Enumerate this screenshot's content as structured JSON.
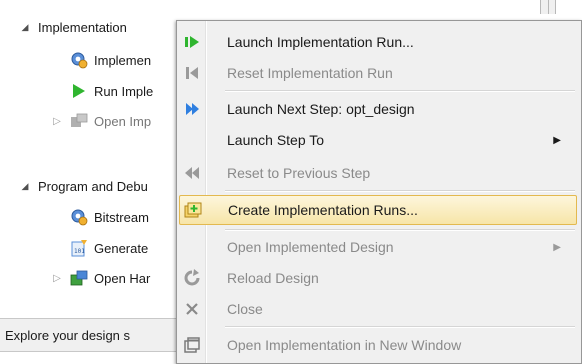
{
  "navigator": {
    "implementation": {
      "label": "Implementation",
      "items": [
        {
          "label": "Implemen"
        },
        {
          "label": "Run Imple"
        },
        {
          "label": "Open Imp"
        }
      ]
    },
    "program_debug": {
      "label": "Program and Debu",
      "items": [
        {
          "label": "Bitstream"
        },
        {
          "label": "Generate"
        },
        {
          "label": "Open Har"
        }
      ]
    }
  },
  "status_bar": {
    "text": "Explore your design s"
  },
  "context_menu": {
    "items": [
      {
        "label": "Launch Implementation Run...",
        "icon": "launch-run-icon",
        "enabled": true
      },
      {
        "label": "Reset Implementation Run",
        "icon": "reset-run-icon",
        "enabled": false
      },
      {
        "label": "Launch Next Step: opt_design",
        "icon": "launch-next-step-icon",
        "enabled": true
      },
      {
        "label": "Launch Step To",
        "icon": "",
        "enabled": true,
        "submenu": true
      },
      {
        "label": "Reset to Previous Step",
        "icon": "reset-previous-step-icon",
        "enabled": false
      },
      {
        "label": "Create Implementation Runs...",
        "icon": "create-runs-icon",
        "enabled": true,
        "highlighted": true
      },
      {
        "label": "Open Implemented Design",
        "icon": "",
        "enabled": false,
        "submenu": true
      },
      {
        "label": "Reload Design",
        "icon": "reload-icon",
        "enabled": false
      },
      {
        "label": "Close",
        "icon": "close-icon",
        "enabled": false
      },
      {
        "label": "Open Implementation in New Window",
        "icon": "new-window-icon",
        "enabled": false
      }
    ]
  },
  "colors": {
    "highlight_border": "#e3b94f",
    "highlight_fill": "#f7e5a8",
    "run_green": "#2fb52f",
    "launch_blue": "#2f7fe0"
  }
}
